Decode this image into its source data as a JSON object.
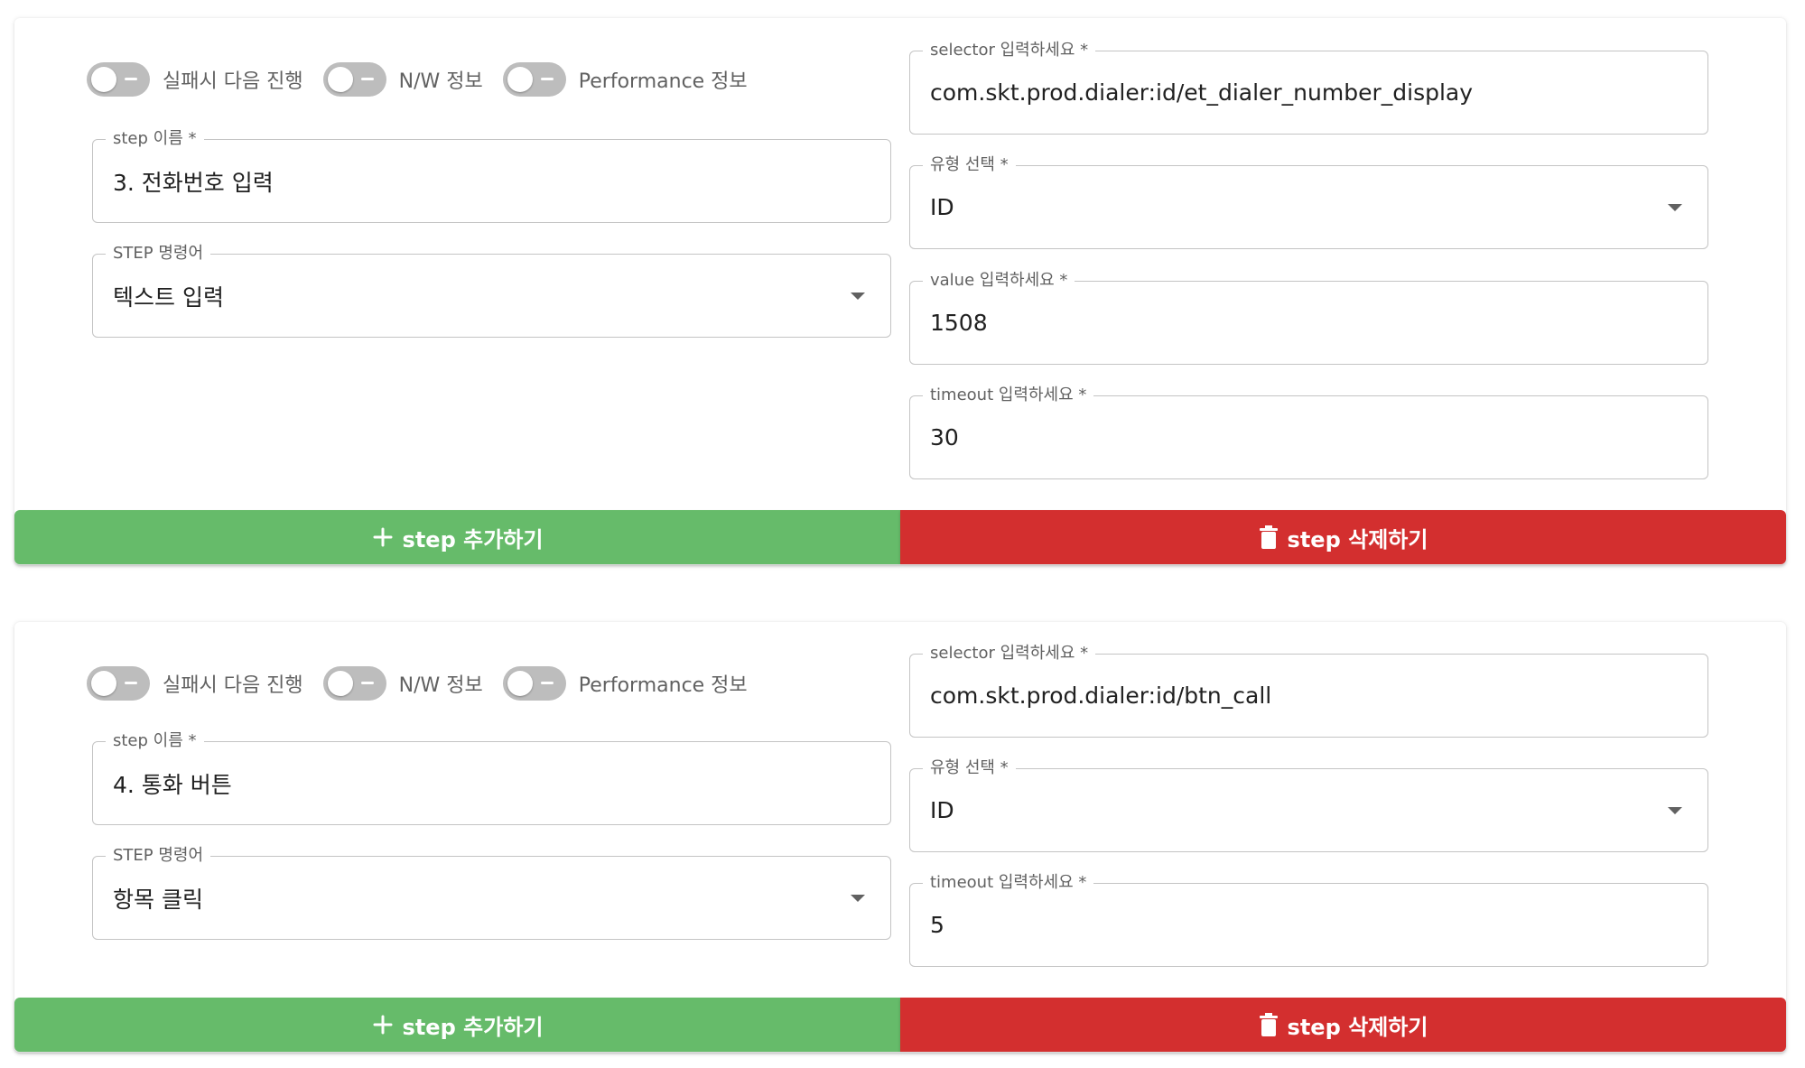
{
  "steps": [
    {
      "toggles": [
        {
          "label": "실패시 다음 진행",
          "on": false
        },
        {
          "label": "N/W 정보",
          "on": false
        },
        {
          "label": "Performance 정보",
          "on": false
        }
      ],
      "step_name": {
        "label": "step 이름 *",
        "value": "3. 전화번호 입력"
      },
      "command": {
        "label": "STEP 명령어",
        "value": "텍스트 입력"
      },
      "selector": {
        "label": "selector 입력하세요 *",
        "value": "com.skt.prod.dialer:id/et_dialer_number_display"
      },
      "type": {
        "label": "유형 선택 *",
        "value": "ID"
      },
      "value_field": {
        "label": "value 입력하세요 *",
        "value": "1508"
      },
      "timeout": {
        "label": "timeout 입력하세요 *",
        "value": "30"
      },
      "add_button": "step 추가하기",
      "delete_button": "step 삭제하기"
    },
    {
      "toggles": [
        {
          "label": "실패시 다음 진행",
          "on": false
        },
        {
          "label": "N/W 정보",
          "on": false
        },
        {
          "label": "Performance 정보",
          "on": false
        }
      ],
      "step_name": {
        "label": "step 이름 *",
        "value": "4. 통화 버튼"
      },
      "command": {
        "label": "STEP 명령어",
        "value": "항목 클릭"
      },
      "selector": {
        "label": "selector 입력하세요 *",
        "value": "com.skt.prod.dialer:id/btn_call"
      },
      "type": {
        "label": "유형 선택 *",
        "value": "ID"
      },
      "timeout": {
        "label": "timeout 입력하세요 *",
        "value": "5"
      },
      "add_button": "step 추가하기",
      "delete_button": "step 삭제하기"
    }
  ],
  "colors": {
    "add": "#66bb6a",
    "delete": "#d32f2f",
    "switch_off": "#bdbdbd"
  },
  "icons": {
    "add": "plus-icon",
    "delete": "trash-icon",
    "select": "chevron-down-icon"
  }
}
